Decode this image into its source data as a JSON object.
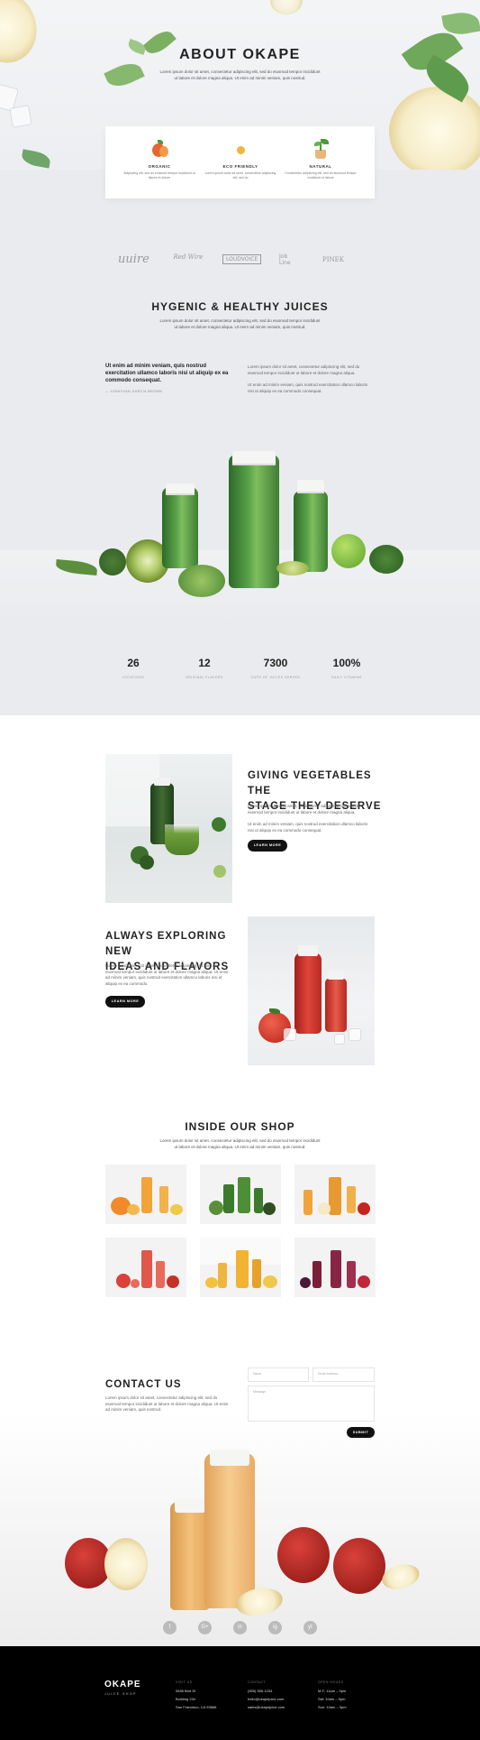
{
  "hero": {
    "title": "ABOUT OKAPE",
    "text": "Lorem ipsum dolor sit amet, consectetur adipiscing elit, sed do eiusmod tempor incididunt ut labore et dolore magna aliqua. Ut enim ad minim veniam, quis nostrud."
  },
  "features": [
    {
      "title": "ORGANIC",
      "text": "Adipiscing elit, sed do eiusmod tempor incididunt ut labore et dolore",
      "icon": "orange-fruit-icon",
      "color": "#e8662f"
    },
    {
      "title": "ECO FRIENDLY",
      "text": "Lorem ipsum dolor sit amet, consectetur adipiscing elit, sed do",
      "icon": "sun-dot-icon",
      "color": "#f2b43a"
    },
    {
      "title": "NATURAL",
      "text": "Consectetur adipiscing elit, sed do eiusmod tempor incididunt ut labore",
      "icon": "potted-plant-icon",
      "color": "#4d9a3c"
    }
  ],
  "logos": [
    "uuire",
    "Red Wire",
    "LOUDVOICE",
    "Job Line",
    "PINEK"
  ],
  "hygenic": {
    "title": "HYGENIC & HEALTHY JUICES",
    "text": "Lorem ipsum dolor sit amet, consectetur adipiscing elit, sed do eiusmod tempor incididunt ut labore et dolore magna aliqua. Ut enim ad minim veniam, quis nostrud.",
    "quote": "Ut enim ad minim veniam, quis nostrud exercitation ullamco laboris nisi ut aliquip ex ea commodo consequat.",
    "quote_author": "— JONATHAN GARCIA BROWN",
    "para1": "Lorem ipsum dolor sit amet, consectetur adipiscing elit, sed do eiusmod tempor incididunt ut labore et dolore magna aliqua.",
    "para2": "Ut enim ad minim veniam, quis nostrud exercitation ullamco laboris nisi ut aliquip ex ea commodo consequat."
  },
  "stats": [
    {
      "num": "26",
      "label": "LOCATIONS"
    },
    {
      "num": "12",
      "label": "ORIGINAL FLAVORS"
    },
    {
      "num": "7300",
      "label": "CUPS OF JUICES SERVED"
    },
    {
      "num": "100%",
      "label": "DAILY VITAMINS"
    }
  ],
  "veg": {
    "title_line1": "GIVING VEGETABLES THE",
    "title_line2": "STAGE THEY DESERVE",
    "p1": "Lorem ipsum dolor sit amet, consectetur adipiscing elit, sed do eiusmod tempor incididunt ut labore et dolore magna aliqua.",
    "p2": "Ut enim ad minim veniam, quis nostrud exercitation ullamco laboris nisi ut aliquip ex ea commodo consequat.",
    "button": "LEARN MORE"
  },
  "explore": {
    "title_line1": "ALWAYS EXPLORING NEW",
    "title_line2": "IDEAS AND FLAVORS",
    "p1": "Lorem ipsum dolor sit amet, consectetur adipiscing elit, sed do eiusmod tempor incididunt ut labore et dolore magna aliqua. Ut enim ad minim veniam, quis nostrud exercitation ullamco laboris nisi ut aliquip ex ea commodo.",
    "button": "LEARN MORE"
  },
  "shop": {
    "title": "INSIDE OUR SHOP",
    "text": "Lorem ipsum dolor sit amet, consectetur adipiscing elit, sed do eiusmod tempor incididunt ut labore et dolore magna aliqua. Ut enim ad minim veniam, quis nostrud."
  },
  "contact": {
    "title": "CONTACT US",
    "text": "Lorem ipsum dolor sit amet, consectetur adipiscing elit, sed do eiusmod tempor incididunt ut labore et dolore magna aliqua. Ut enim ad minim veniam, quis nostrud.",
    "name_placeholder": "Name",
    "email_placeholder": "Email Address",
    "message_placeholder": "Message",
    "submit": "SUBMIT"
  },
  "social": [
    "f",
    "G+",
    "in",
    "ig",
    "yt"
  ],
  "footer": {
    "brand": "OKAPE",
    "tagline": "JUICE SHOP",
    "visit_heading": "VISIT US",
    "visit_lines": [
      "0658 Bird St",
      "Building 234",
      "San Francisco, CA 93868"
    ],
    "contact_heading": "CONTACT",
    "contact_lines": [
      "(555) 555-1234",
      "hello@okapejuice.com",
      "sales@okapejuice.com"
    ],
    "hours_heading": "OPEN HOURS",
    "hours_lines": [
      "M-F: 11am – 9pm",
      "Sat: 10am – 9pm",
      "Sun: 10am – 9pm"
    ]
  },
  "colors": {
    "accent_dark": "#111111",
    "band_grey": "#e9ebee",
    "juice_green": "#5aa349",
    "juice_red": "#d9413a",
    "juice_orange": "#f0a43a"
  }
}
